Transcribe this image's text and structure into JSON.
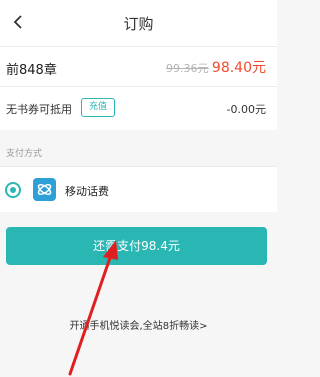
{
  "header": {
    "title": "订购"
  },
  "order": {
    "chapter": "前848章",
    "original_price": "99.36元",
    "sale_price": "98.40元",
    "coupon_text": "无书券可抵用",
    "recharge_label": "充值",
    "coupon_amount": "-0.00元"
  },
  "payment": {
    "section_label": "支付方式",
    "method": "移动话费"
  },
  "actions": {
    "pay_label": "还需支付98.4元"
  },
  "promo": {
    "text": "开通手机悦读会,全站8折畅读",
    "chevron": ">"
  },
  "colors": {
    "accent": "#2ab7b4",
    "price": "#f24a2e",
    "annotation": "#e02020"
  },
  "icons": {
    "back": "chevron-left-icon",
    "payment": "china-mobile-icon"
  }
}
